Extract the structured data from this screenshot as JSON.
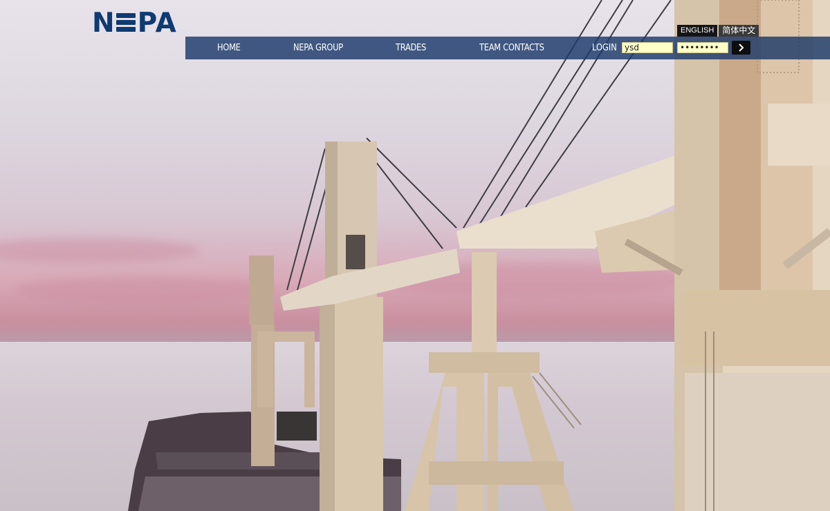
{
  "header": {
    "logo": {
      "text": "NEPA",
      "color": "#0f3a72"
    },
    "languages": [
      "ENGLISH",
      "简体中文"
    ],
    "nav": [
      {
        "label": "HOME"
      },
      {
        "label": "NEPA GROUP"
      },
      {
        "label": "TRADES"
      },
      {
        "label": "TEAM CONTACTS"
      }
    ],
    "login": {
      "label": "LOGIN",
      "username": "ysd",
      "password": "••••••••",
      "submit_icon": "chevron-right-icon"
    },
    "navbar_color": "#1c3a6a"
  },
  "hero": {
    "image": "ship-deck-cranes-at-sunset"
  }
}
